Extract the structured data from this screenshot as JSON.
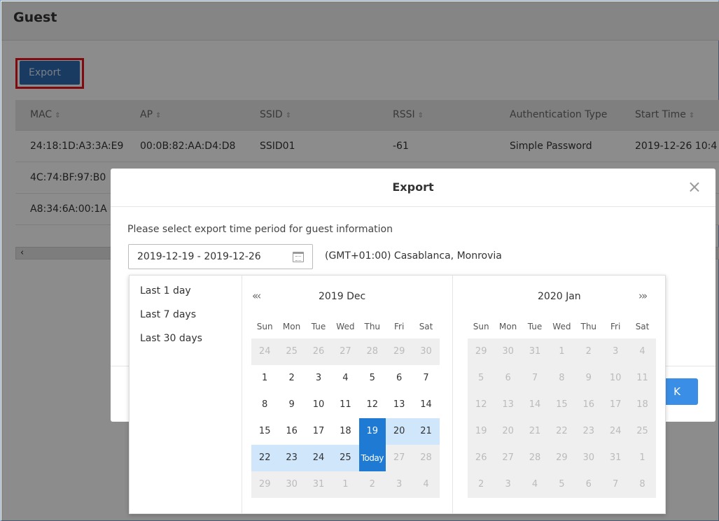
{
  "page": {
    "title": "Guest"
  },
  "toolbar": {
    "export_label": "Export"
  },
  "table": {
    "headers": [
      "MAC",
      "AP",
      "SSID",
      "RSSI",
      "Authentication Type",
      "Start Time"
    ],
    "rows": [
      [
        "24:18:1D:A3:3A:E9",
        "00:0B:82:AA:D4:D8",
        "SSID01",
        "-61",
        "Simple Password",
        "2019-12-26 10:4"
      ],
      [
        "4C:74:BF:97:B0",
        "",
        "",
        "",
        "",
        ""
      ],
      [
        "A8:34:6A:00:1A",
        "",
        "",
        "",
        "",
        ""
      ]
    ],
    "scroll_left_arrow": "‹"
  },
  "modal": {
    "title": "Export",
    "close": "×",
    "prompt": "Please select export time period for guest information",
    "date_range": "2019-12-19 - 2019-12-26",
    "timezone": "(GMT+01:00) Casablanca, Monrovia",
    "ok_label": "K"
  },
  "picker": {
    "ranges": [
      "Last 1 day",
      "Last 7 days",
      "Last 30 days"
    ],
    "prev_nav": "«‹",
    "next_nav": "›»",
    "left": {
      "title": "2019 Dec",
      "dow": [
        "Sun",
        "Mon",
        "Tue",
        "Wed",
        "Thu",
        "Fri",
        "Sat"
      ],
      "weeks": [
        [
          {
            "d": "24",
            "s": "off"
          },
          {
            "d": "25",
            "s": "off"
          },
          {
            "d": "26",
            "s": "off"
          },
          {
            "d": "27",
            "s": "off"
          },
          {
            "d": "28",
            "s": "off"
          },
          {
            "d": "29",
            "s": "off"
          },
          {
            "d": "30",
            "s": "off"
          }
        ],
        [
          {
            "d": "1"
          },
          {
            "d": "2"
          },
          {
            "d": "3"
          },
          {
            "d": "4"
          },
          {
            "d": "5"
          },
          {
            "d": "6"
          },
          {
            "d": "7"
          }
        ],
        [
          {
            "d": "8"
          },
          {
            "d": "9"
          },
          {
            "d": "10"
          },
          {
            "d": "11"
          },
          {
            "d": "12"
          },
          {
            "d": "13"
          },
          {
            "d": "14"
          }
        ],
        [
          {
            "d": "15"
          },
          {
            "d": "16"
          },
          {
            "d": "17"
          },
          {
            "d": "18"
          },
          {
            "d": "19",
            "s": "sel"
          },
          {
            "d": "20",
            "s": "in"
          },
          {
            "d": "21",
            "s": "in"
          }
        ],
        [
          {
            "d": "22",
            "s": "in"
          },
          {
            "d": "23",
            "s": "in"
          },
          {
            "d": "24",
            "s": "in"
          },
          {
            "d": "25",
            "s": "in"
          },
          {
            "d": "Today",
            "s": "sel today"
          },
          {
            "d": "27",
            "s": "off"
          },
          {
            "d": "28",
            "s": "off"
          }
        ],
        [
          {
            "d": "29",
            "s": "off"
          },
          {
            "d": "30",
            "s": "off"
          },
          {
            "d": "31",
            "s": "off"
          },
          {
            "d": "1",
            "s": "off"
          },
          {
            "d": "2",
            "s": "off"
          },
          {
            "d": "3",
            "s": "off"
          },
          {
            "d": "4",
            "s": "off"
          }
        ]
      ]
    },
    "right": {
      "title": "2020 Jan",
      "dow": [
        "Sun",
        "Mon",
        "Tue",
        "Wed",
        "Thu",
        "Fri",
        "Sat"
      ],
      "weeks": [
        [
          {
            "d": "29",
            "s": "off"
          },
          {
            "d": "30",
            "s": "off"
          },
          {
            "d": "31",
            "s": "off"
          },
          {
            "d": "1",
            "s": "off"
          },
          {
            "d": "2",
            "s": "off"
          },
          {
            "d": "3",
            "s": "off"
          },
          {
            "d": "4",
            "s": "off"
          }
        ],
        [
          {
            "d": "5",
            "s": "off"
          },
          {
            "d": "6",
            "s": "off"
          },
          {
            "d": "7",
            "s": "off"
          },
          {
            "d": "8",
            "s": "off"
          },
          {
            "d": "9",
            "s": "off"
          },
          {
            "d": "10",
            "s": "off"
          },
          {
            "d": "11",
            "s": "off"
          }
        ],
        [
          {
            "d": "12",
            "s": "off"
          },
          {
            "d": "13",
            "s": "off"
          },
          {
            "d": "14",
            "s": "off"
          },
          {
            "d": "15",
            "s": "off"
          },
          {
            "d": "16",
            "s": "off"
          },
          {
            "d": "17",
            "s": "off"
          },
          {
            "d": "18",
            "s": "off"
          }
        ],
        [
          {
            "d": "19",
            "s": "off"
          },
          {
            "d": "20",
            "s": "off"
          },
          {
            "d": "21",
            "s": "off"
          },
          {
            "d": "22",
            "s": "off"
          },
          {
            "d": "23",
            "s": "off"
          },
          {
            "d": "24",
            "s": "off"
          },
          {
            "d": "25",
            "s": "off"
          }
        ],
        [
          {
            "d": "26",
            "s": "off"
          },
          {
            "d": "27",
            "s": "off"
          },
          {
            "d": "28",
            "s": "off"
          },
          {
            "d": "29",
            "s": "off"
          },
          {
            "d": "30",
            "s": "off"
          },
          {
            "d": "31",
            "s": "off"
          },
          {
            "d": "1",
            "s": "off"
          }
        ],
        [
          {
            "d": "2",
            "s": "off"
          },
          {
            "d": "3",
            "s": "off"
          },
          {
            "d": "4",
            "s": "off"
          },
          {
            "d": "5",
            "s": "off"
          },
          {
            "d": "6",
            "s": "off"
          },
          {
            "d": "7",
            "s": "off"
          },
          {
            "d": "8",
            "s": "off"
          }
        ]
      ]
    }
  },
  "colors": {
    "primary": "#2f6bb1",
    "highlight_border": "#e8131e",
    "selected_day": "#1e7ad2",
    "in_range_day": "#d0e6fb",
    "ok_button": "#3a8ee6"
  }
}
